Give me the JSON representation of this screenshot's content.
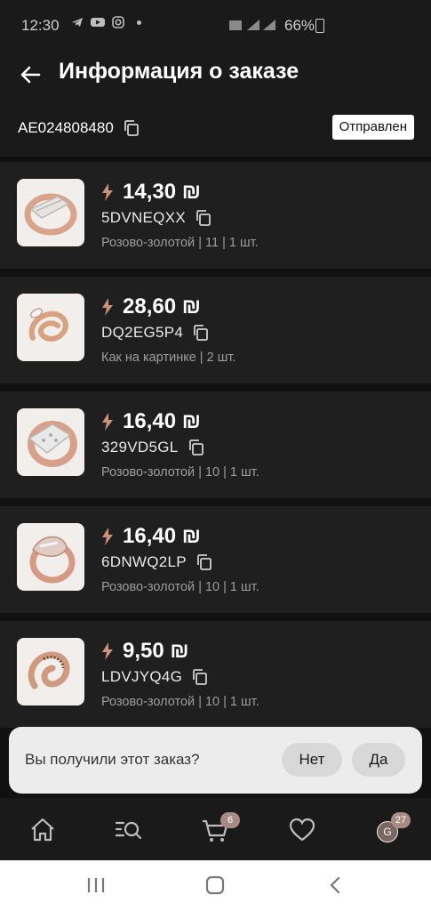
{
  "status_bar": {
    "time": "12:30",
    "battery": "66%"
  },
  "header": {
    "title": "Информация о заказе",
    "order_id": "AE024808480",
    "status": "Отправлен"
  },
  "items": [
    {
      "price": "14,30 ₪",
      "sku": "5DVNEQXX",
      "variant": "Розово-золотой | 11 | 1 шт."
    },
    {
      "price": "28,60 ₪",
      "sku": "DQ2EG5P4",
      "variant": "Как на картинке | 2 шт."
    },
    {
      "price": "16,40 ₪",
      "sku": "329VD5GL",
      "variant": "Розово-золотой | 10 | 1 шт."
    },
    {
      "price": "16,40 ₪",
      "sku": "6DNWQ2LP",
      "variant": "Розово-золотой | 10 | 1 шт."
    },
    {
      "price": "9,50 ₪",
      "sku": "LDVJYQ4G",
      "variant": "Розово-золотой | 10 | 1 шт."
    }
  ],
  "prompt": {
    "question": "Вы получили этот заказ?",
    "no_label": "Нет",
    "yes_label": "Да"
  },
  "bottom_nav": {
    "cart_badge": "6",
    "profile_badge": "27",
    "avatar_letter": "G",
    "items": [
      "home-icon",
      "search-catalog-icon",
      "cart-icon",
      "heart-icon",
      "profile-avatar"
    ]
  },
  "colors": {
    "accent": "#c9927c",
    "badge": "#a98b86",
    "background": "#111111",
    "card": "#1f1f1f"
  }
}
